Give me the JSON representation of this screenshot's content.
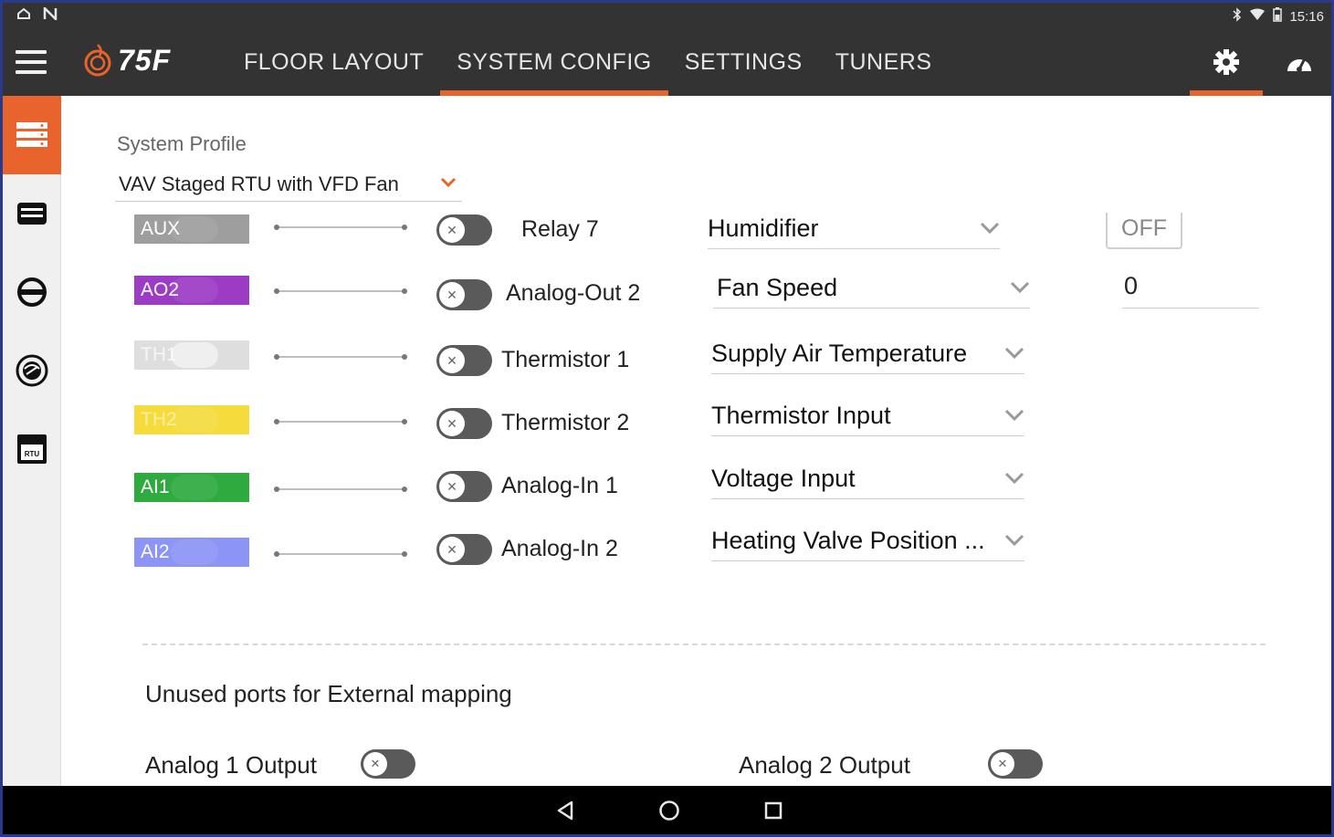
{
  "status_bar": {
    "left_icons": [
      "cloud-icon",
      "n-icon"
    ],
    "right_icons": [
      "bluetooth-icon",
      "wifi-icon",
      "battery-icon"
    ],
    "time": "15:16"
  },
  "top_nav": {
    "logo_text": "75F",
    "tabs": [
      {
        "label": "FLOOR LAYOUT",
        "active": false
      },
      {
        "label": "SYSTEM CONFIG",
        "active": true
      },
      {
        "label": "SETTINGS",
        "active": false
      },
      {
        "label": "TUNERS",
        "active": false
      }
    ],
    "icons": [
      "gear-icon",
      "dashboard-icon"
    ],
    "accent_color": "#e8642c"
  },
  "rail": {
    "items": [
      "system-profile-icon",
      "equipment-icon",
      "no-entry-icon",
      "fan-icon",
      "rtu-icon"
    ],
    "rtu_label": "RTU"
  },
  "system_profile": {
    "label": "System Profile",
    "value": "VAV Staged RTU with VFD Fan"
  },
  "ports": [
    {
      "chip": "AUX",
      "color": "#9e9e9e",
      "name": "Relay 7",
      "mapping": "Humidifier",
      "extra_type": "button",
      "extra_value": "OFF"
    },
    {
      "chip": "AO2",
      "color": "#9c3bc4",
      "name": "Analog-Out 2",
      "mapping": "Fan Speed",
      "extra_type": "field",
      "extra_value": "0"
    },
    {
      "chip": "TH1",
      "color": "#dedede",
      "name": "Thermistor 1",
      "mapping": "Supply Air Temperature"
    },
    {
      "chip": "TH2",
      "color": "#f5dc3c",
      "name": "Thermistor 2",
      "mapping": "Thermistor Input"
    },
    {
      "chip": "AI1",
      "color": "#2eaa3e",
      "name": "Analog-In 1",
      "mapping": "Voltage Input"
    },
    {
      "chip": "AI2",
      "color": "#8c94f5",
      "name": "Analog-In 2",
      "mapping": "Heating Valve Position ..."
    }
  ],
  "unused": {
    "title": "Unused ports for External mapping",
    "items": [
      "Analog 1 Output",
      "Analog 2 Output"
    ]
  },
  "nav_bar": {
    "buttons": [
      "back-icon",
      "home-icon",
      "recents-icon"
    ]
  }
}
